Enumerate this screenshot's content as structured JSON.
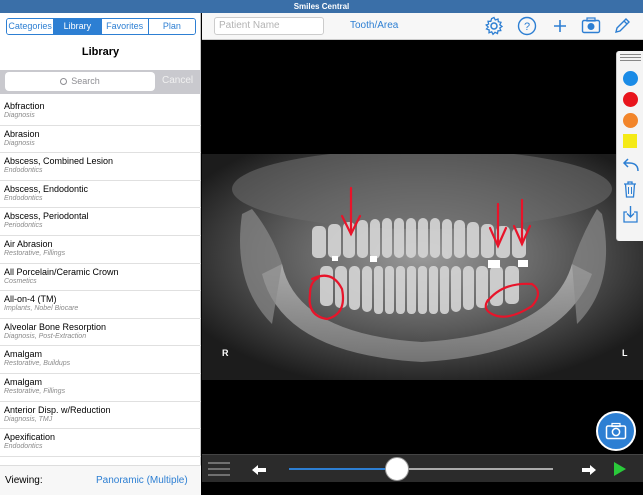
{
  "app": {
    "title": "Smiles Central"
  },
  "sidebar": {
    "tabs": [
      {
        "label": "Categories",
        "active": false
      },
      {
        "label": "Library",
        "active": true
      },
      {
        "label": "Favorites",
        "active": false
      },
      {
        "label": "Plan",
        "active": false
      }
    ],
    "title": "Library",
    "search": {
      "placeholder": "Search",
      "cancel_label": "Cancel"
    },
    "items": [
      {
        "title": "Abfraction",
        "subtitle": "Diagnosis"
      },
      {
        "title": "Abrasion",
        "subtitle": "Diagnosis"
      },
      {
        "title": "Abscess, Combined Lesion",
        "subtitle": "Endodontics"
      },
      {
        "title": "Abscess, Endodontic",
        "subtitle": "Endodontics"
      },
      {
        "title": "Abscess, Periodontal",
        "subtitle": "Periodontics"
      },
      {
        "title": "Air Abrasion",
        "subtitle": "Restorative, Fillings"
      },
      {
        "title": "All Porcelain/Ceramic Crown",
        "subtitle": "Cosmetics"
      },
      {
        "title": "All-on-4 (TM)",
        "subtitle": "Implants, Nobel Biocare"
      },
      {
        "title": "Alveolar Bone Resorption",
        "subtitle": "Diagnosis, Post-Extraction"
      },
      {
        "title": "Amalgam",
        "subtitle": "Restorative, Buildups"
      },
      {
        "title": "Amalgam",
        "subtitle": "Restorative, Fillings"
      },
      {
        "title": "Anterior Disp. w/Reduction",
        "subtitle": "Diagnosis, TMJ"
      },
      {
        "title": "Apexification",
        "subtitle": "Endodontics"
      }
    ],
    "viewing_label": "Viewing:",
    "viewing_value": "Panoramic (Multiple)"
  },
  "toolbar": {
    "patient_placeholder": "Patient Name",
    "tooth_area_label": "Tooth/Area",
    "icons": [
      "gear-icon",
      "help-icon",
      "plus-icon",
      "camera-icon",
      "pencil-icon"
    ]
  },
  "xray": {
    "left_marker": "R",
    "right_marker": "L"
  },
  "palette": {
    "colors": [
      "#1a8be6",
      "#e8141c",
      "#f2852a",
      "#f4ea16"
    ],
    "icons": [
      "undo-icon",
      "trash-icon",
      "save-icon"
    ]
  },
  "playback": {
    "progress": 0.41
  },
  "colors": {
    "accent": "#2d7fd3",
    "annotation": "#e8142a"
  }
}
